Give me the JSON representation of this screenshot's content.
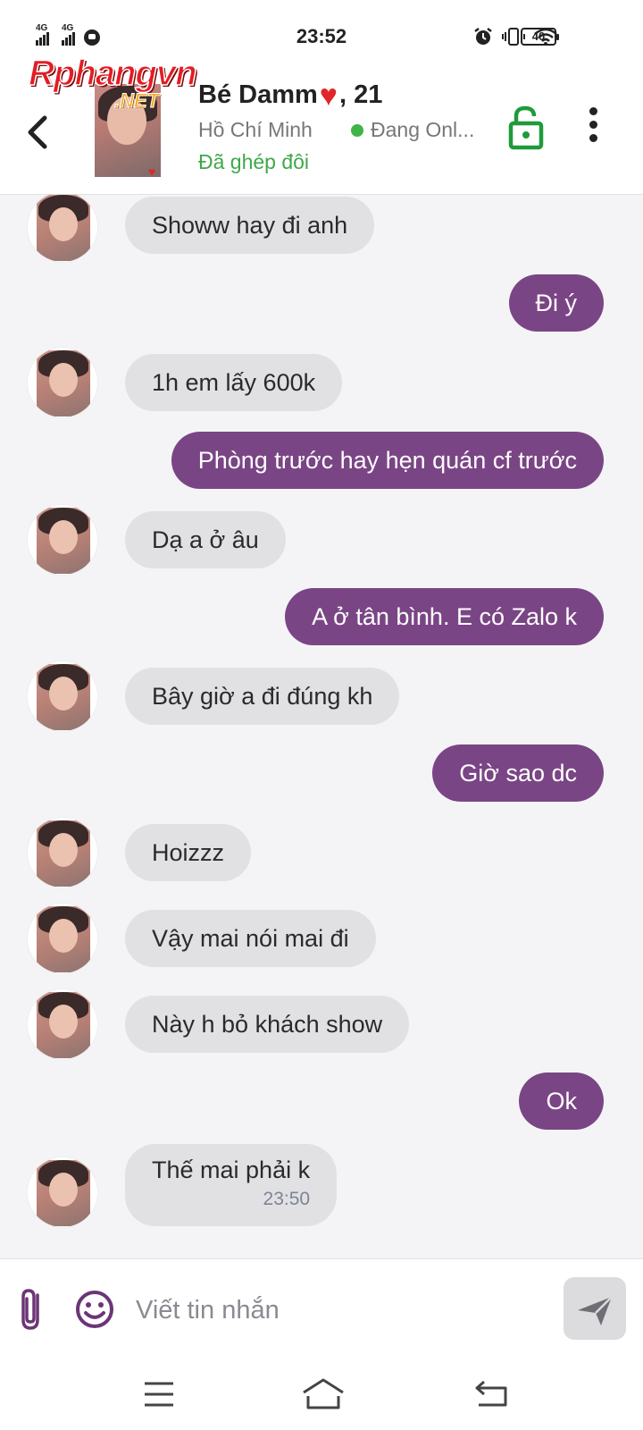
{
  "status_bar": {
    "time": "23:52",
    "network_1": "4G",
    "network_2": "4G",
    "battery": "40"
  },
  "watermark": {
    "main": "Rphangvn",
    "sub": ".NET"
  },
  "header": {
    "name": "Bé Damm",
    "name_emoji": "❤️",
    "age": ", 21",
    "location": "Hồ Chí Minh",
    "online_status": "Đang Onl...",
    "match_status": "Đã ghép đôi"
  },
  "colors": {
    "outgoing_bubble": "#7a4585",
    "incoming_bubble": "#e1e1e4",
    "online_dot": "#3fb548",
    "match_text": "#3fa84a",
    "icon_purple": "#6b3577",
    "lock_green": "#1e9b3a"
  },
  "messages": [
    {
      "dir": "in",
      "text": "Showw hay đi anh"
    },
    {
      "dir": "out",
      "text": "Đi ý"
    },
    {
      "dir": "in",
      "text": "1h em lấy 600k"
    },
    {
      "dir": "out",
      "text": "Phòng trước hay hẹn quán cf trước"
    },
    {
      "dir": "in",
      "text": "Dạ a ở âu"
    },
    {
      "dir": "out",
      "text": "A ở tân bình. E có Zalo k"
    },
    {
      "dir": "in",
      "text": "Bây giờ a đi đúng kh"
    },
    {
      "dir": "out",
      "text": "Giờ sao dc"
    },
    {
      "dir": "in",
      "text": "Hoizzz"
    },
    {
      "dir": "in",
      "text": "Vậy mai nói mai đi"
    },
    {
      "dir": "in",
      "text": "Này h bỏ khách show"
    },
    {
      "dir": "out",
      "text": "Ok"
    },
    {
      "dir": "in",
      "text": "Thế mai phải k",
      "time": "23:50"
    }
  ],
  "composer": {
    "placeholder": "Viết tin nhắn",
    "value": ""
  },
  "icons": {
    "back": "chevron-left-icon",
    "lock": "unlocked-padlock-icon",
    "more": "more-vertical-icon",
    "attach": "paperclip-icon",
    "emoji": "smiley-icon",
    "send": "paper-plane-icon"
  }
}
